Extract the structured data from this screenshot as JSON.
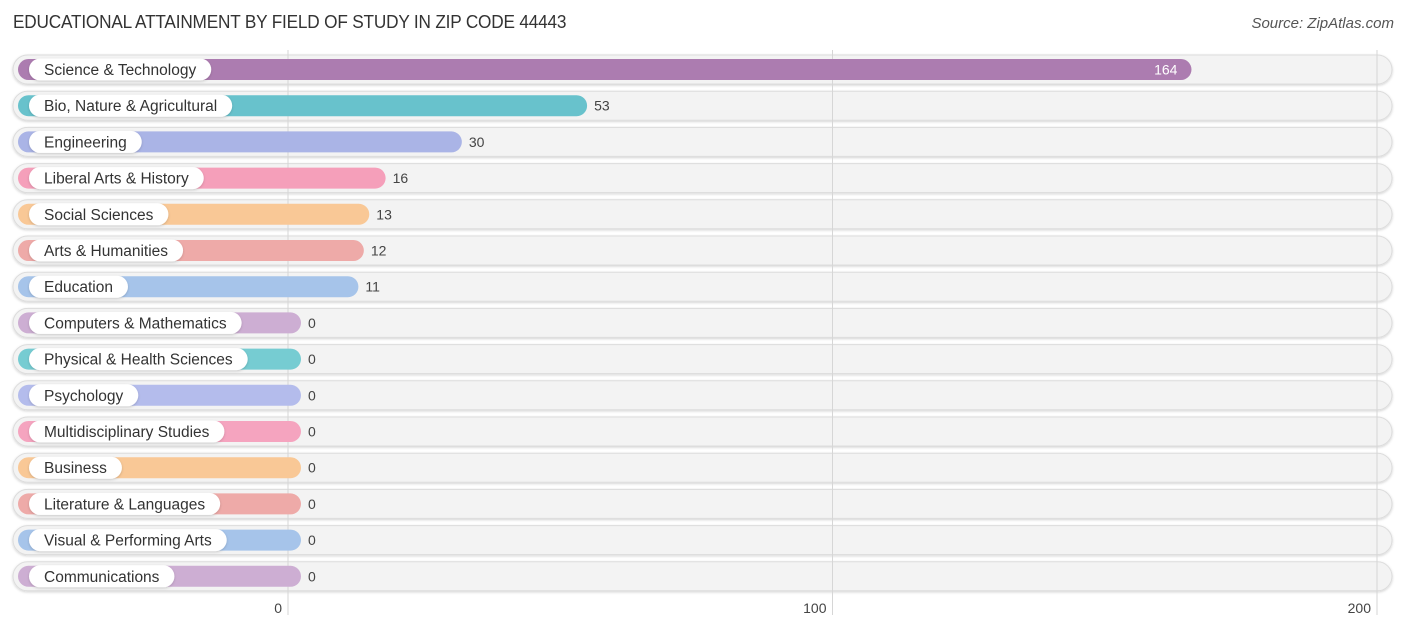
{
  "chart_data": {
    "type": "bar",
    "orientation": "horizontal",
    "title": "EDUCATIONAL ATTAINMENT BY FIELD OF STUDY IN ZIP CODE 44443",
    "source": "Source: ZipAtlas.com",
    "xlabel": "",
    "ylabel": "",
    "xlim": [
      0,
      200
    ],
    "xticks": [
      0,
      100,
      200
    ],
    "grid": true,
    "categories": [
      "Science & Technology",
      "Bio, Nature & Agricultural",
      "Engineering",
      "Liberal Arts & History",
      "Social Sciences",
      "Arts & Humanities",
      "Education",
      "Computers & Mathematics",
      "Physical & Health Sciences",
      "Psychology",
      "Multidisciplinary Studies",
      "Business",
      "Literature & Languages",
      "Visual & Performing Arts",
      "Communications"
    ],
    "values": [
      164,
      53,
      30,
      16,
      13,
      12,
      11,
      0,
      0,
      0,
      0,
      0,
      0,
      0,
      0
    ],
    "colors": [
      "#ac7cb0",
      "#68c2cc",
      "#aab4e6",
      "#f59fba",
      "#f9c896",
      "#eeaaa8",
      "#a6c4ea",
      "#cdaed3",
      "#76ccd2",
      "#b4bcec",
      "#f5a4bf",
      "#f9c896",
      "#eeaaa8",
      "#a6c4ea",
      "#cdaed3"
    ]
  }
}
